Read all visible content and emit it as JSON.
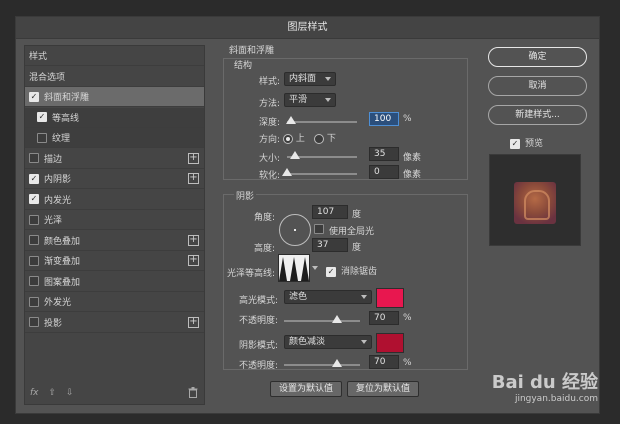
{
  "dialog": {
    "title": "图层样式"
  },
  "left_panel": {
    "items": [
      {
        "label": "样式",
        "checkbox": false,
        "checked": false,
        "plus": false,
        "selected": false,
        "sub": false
      },
      {
        "label": "混合选项",
        "checkbox": false,
        "checked": false,
        "plus": false,
        "selected": false,
        "sub": false
      },
      {
        "label": "斜面和浮雕",
        "checkbox": true,
        "checked": true,
        "plus": false,
        "selected": true,
        "sub": false
      },
      {
        "label": "等高线",
        "checkbox": true,
        "checked": true,
        "plus": false,
        "selected": false,
        "sub": true
      },
      {
        "label": "纹理",
        "checkbox": true,
        "checked": false,
        "plus": false,
        "selected": false,
        "sub": true
      },
      {
        "label": "描边",
        "checkbox": true,
        "checked": false,
        "plus": true,
        "selected": false,
        "sub": false
      },
      {
        "label": "内阴影",
        "checkbox": true,
        "checked": true,
        "plus": true,
        "selected": false,
        "sub": false
      },
      {
        "label": "内发光",
        "checkbox": true,
        "checked": true,
        "plus": false,
        "selected": false,
        "sub": false
      },
      {
        "label": "光泽",
        "checkbox": true,
        "checked": false,
        "plus": false,
        "selected": false,
        "sub": false
      },
      {
        "label": "颜色叠加",
        "checkbox": true,
        "checked": false,
        "plus": true,
        "selected": false,
        "sub": false
      },
      {
        "label": "渐变叠加",
        "checkbox": true,
        "checked": false,
        "plus": true,
        "selected": false,
        "sub": false
      },
      {
        "label": "图案叠加",
        "checkbox": true,
        "checked": false,
        "plus": false,
        "selected": false,
        "sub": false
      },
      {
        "label": "外发光",
        "checkbox": true,
        "checked": false,
        "plus": false,
        "selected": false,
        "sub": false
      },
      {
        "label": "投影",
        "checkbox": true,
        "checked": false,
        "plus": true,
        "selected": false,
        "sub": false
      }
    ],
    "footer": {
      "fx": "fx",
      "up": "⇧",
      "down": "⇩",
      "trash": "🗑"
    }
  },
  "bevel": {
    "title": "斜面和浮雕",
    "structure": {
      "title": "结构",
      "style_label": "样式:",
      "style_value": "内斜面",
      "technique_label": "方法:",
      "technique_value": "平滑",
      "depth_label": "深度:",
      "depth_value": "100",
      "depth_unit": "%",
      "depth_level": 0.05,
      "direction_label": "方向:",
      "dir_up": "上",
      "dir_down": "下",
      "size_label": "大小:",
      "size_value": "35",
      "size_unit": "像素",
      "size_level": 0.12,
      "soften_label": "软化:",
      "soften_value": "0",
      "soften_unit": "像素",
      "soften_level": 0.0
    },
    "shading": {
      "title": "阴影",
      "angle_label": "角度:",
      "angle_value": "107",
      "angle_unit": "度",
      "global_light_label": "使用全局光",
      "altitude_label": "高度:",
      "altitude_value": "37",
      "altitude_unit": "度",
      "gloss_contour_label": "光泽等高线:",
      "antialias_label": "消除锯齿",
      "highlight_mode_label": "高光模式:",
      "highlight_mode_value": "滤色",
      "highlight_color": "#e8174f",
      "highlight_opacity_label": "不透明度:",
      "highlight_opacity_value": "70",
      "highlight_opacity_unit": "%",
      "highlight_opacity_level": 0.7,
      "shadow_mode_label": "阴影模式:",
      "shadow_mode_value": "颜色减淡",
      "shadow_color": "#b01030",
      "shadow_opacity_label": "不透明度:",
      "shadow_opacity_value": "70",
      "shadow_opacity_unit": "%",
      "shadow_opacity_level": 0.7
    },
    "make_default": "设置为默认值",
    "reset_default": "复位为默认值"
  },
  "right": {
    "ok": "确定",
    "cancel": "取消",
    "new_style": "新建样式...",
    "preview_label": "预览"
  },
  "watermark": {
    "brand": "Bai du 经验",
    "url": "jingyan.baidu.com"
  }
}
